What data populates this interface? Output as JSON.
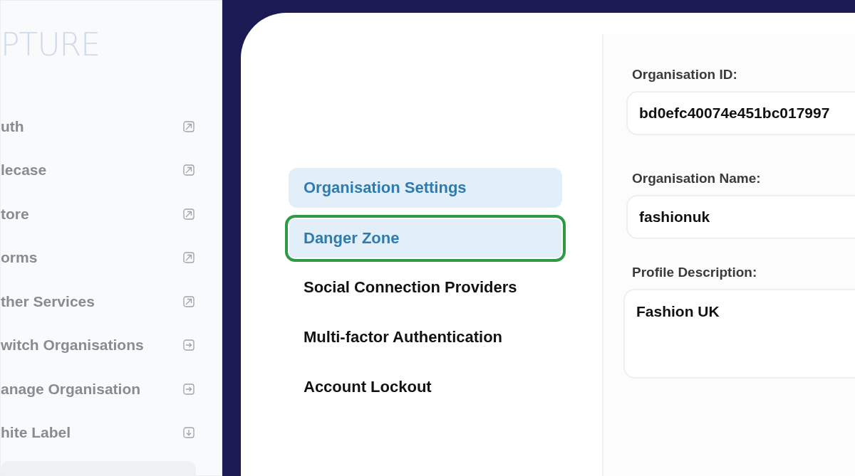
{
  "logo": "PTURE",
  "sidebar": {
    "items": [
      {
        "label": "uth",
        "kind": "external"
      },
      {
        "label": "lecase",
        "kind": "external"
      },
      {
        "label": "tore",
        "kind": "external"
      },
      {
        "label": "orms",
        "kind": "external"
      },
      {
        "label": "ther Services",
        "kind": "external"
      },
      {
        "label": "witch Organisations",
        "kind": "enter"
      },
      {
        "label": "anage Organisation",
        "kind": "enter"
      },
      {
        "label": "hite Label",
        "kind": "download"
      }
    ]
  },
  "settings_menu": [
    {
      "label": "Organisation Settings",
      "selected": true,
      "highlighted": false
    },
    {
      "label": "Danger Zone",
      "selected": true,
      "highlighted": true
    },
    {
      "label": "Social Connection Providers",
      "selected": false,
      "highlighted": false
    },
    {
      "label": "Multi-factor Authentication",
      "selected": false,
      "highlighted": false
    },
    {
      "label": "Account Lockout",
      "selected": false,
      "highlighted": false
    }
  ],
  "fields": [
    {
      "label": "Organisation ID:",
      "value": "bd0efc40074e451bc017997",
      "kind": "input"
    },
    {
      "label": "Organisation Name:",
      "value": "fashionuk",
      "kind": "input"
    },
    {
      "label": "Profile Description:",
      "value": "Fashion UK",
      "kind": "textarea"
    }
  ]
}
